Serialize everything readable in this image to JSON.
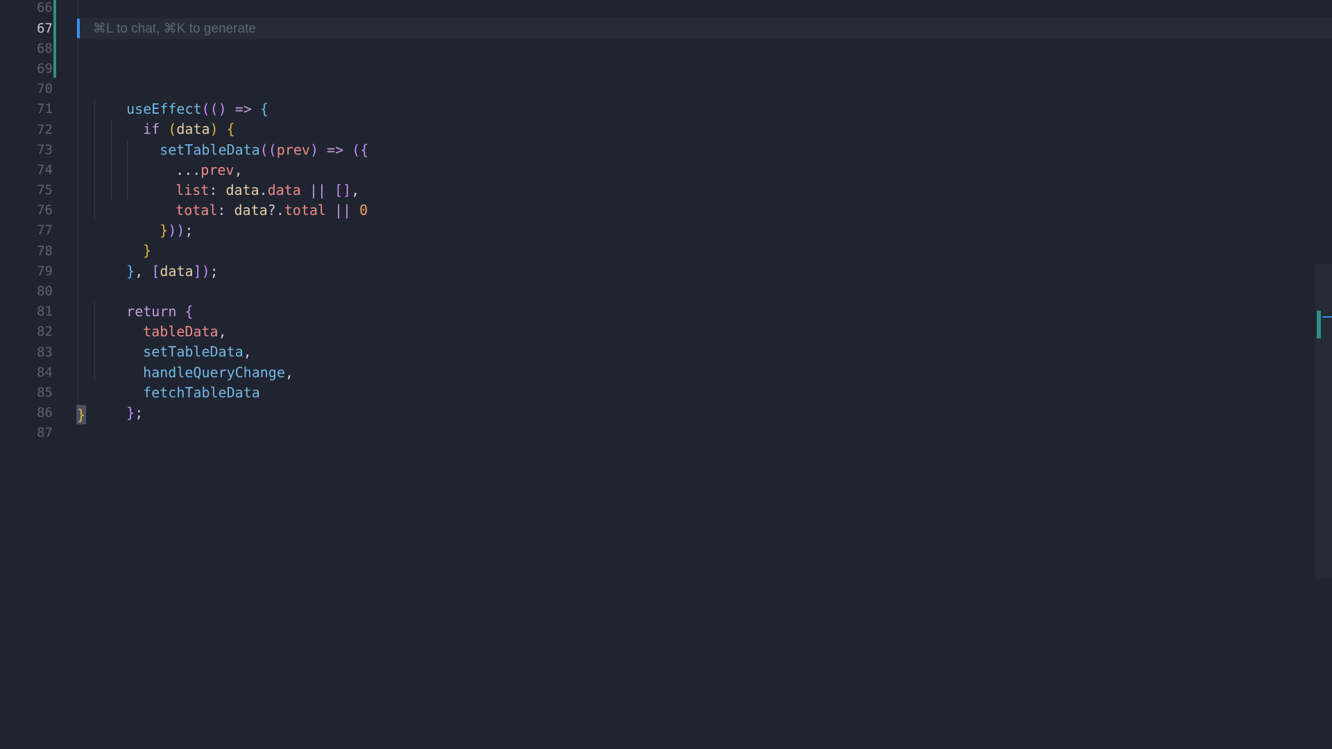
{
  "editor": {
    "hint_text": "⌘L to chat, ⌘K to generate",
    "active_line": "67",
    "line_numbers": [
      "66",
      "67",
      "68",
      "69",
      "70",
      "71",
      "72",
      "73",
      "74",
      "75",
      "76",
      "77",
      "78",
      "79",
      "80",
      "81",
      "82",
      "83",
      "84",
      "85",
      "86",
      "87"
    ],
    "code": {
      "l70": {
        "fn": "useEffect",
        "a": "((",
        "b": ")",
        "c": " => ",
        "d": "{"
      },
      "l71": {
        "kw": "if",
        "a": " (",
        "var": "data",
        "b": ") ",
        "c": "{"
      },
      "l72": {
        "fn": "setTableData",
        "a": "((",
        "var": "prev",
        "b": ")",
        "c": " => ",
        "d": "({"
      },
      "l73": {
        "spread": "...",
        "var": "prev",
        "comma": ","
      },
      "l74": {
        "prop": "list",
        "colon": ": ",
        "obj": "data",
        "dot": ".",
        "prop2": "data",
        "op": " || ",
        "arr": "[]",
        "comma": ","
      },
      "l75": {
        "prop": "total",
        "colon": ": ",
        "obj": "data",
        "dot": "?.",
        "prop2": "total",
        "op": " || ",
        "num": "0"
      },
      "l76": {
        "a": "}",
        "b": "))",
        "c": ";"
      },
      "l77": {
        "a": "}"
      },
      "l78": {
        "a": "}",
        "b": ", ",
        "c": "[",
        "var": "data",
        "d": "]",
        "e": ")",
        "f": ";"
      },
      "l80": {
        "kw": "return",
        "a": " ",
        "b": "{"
      },
      "l81": {
        "prop": "tableData",
        "comma": ","
      },
      "l82": {
        "fn": "setTableData",
        "comma": ","
      },
      "l83": {
        "fn": "handleQueryChange",
        "comma": ","
      },
      "l84": {
        "fn": "fetchTableData"
      },
      "l85": {
        "a": "}",
        "b": ";"
      },
      "l86": {
        "a": "}"
      }
    }
  },
  "colors": {
    "background": "#1f2430",
    "function": "#73b8e6",
    "keyword": "#c79be0",
    "property": "#ef8a8a",
    "variable": "#e9cda6",
    "number": "#f2a35e",
    "modified_gutter": "#2f8f87",
    "cursor": "#3b8eea"
  }
}
